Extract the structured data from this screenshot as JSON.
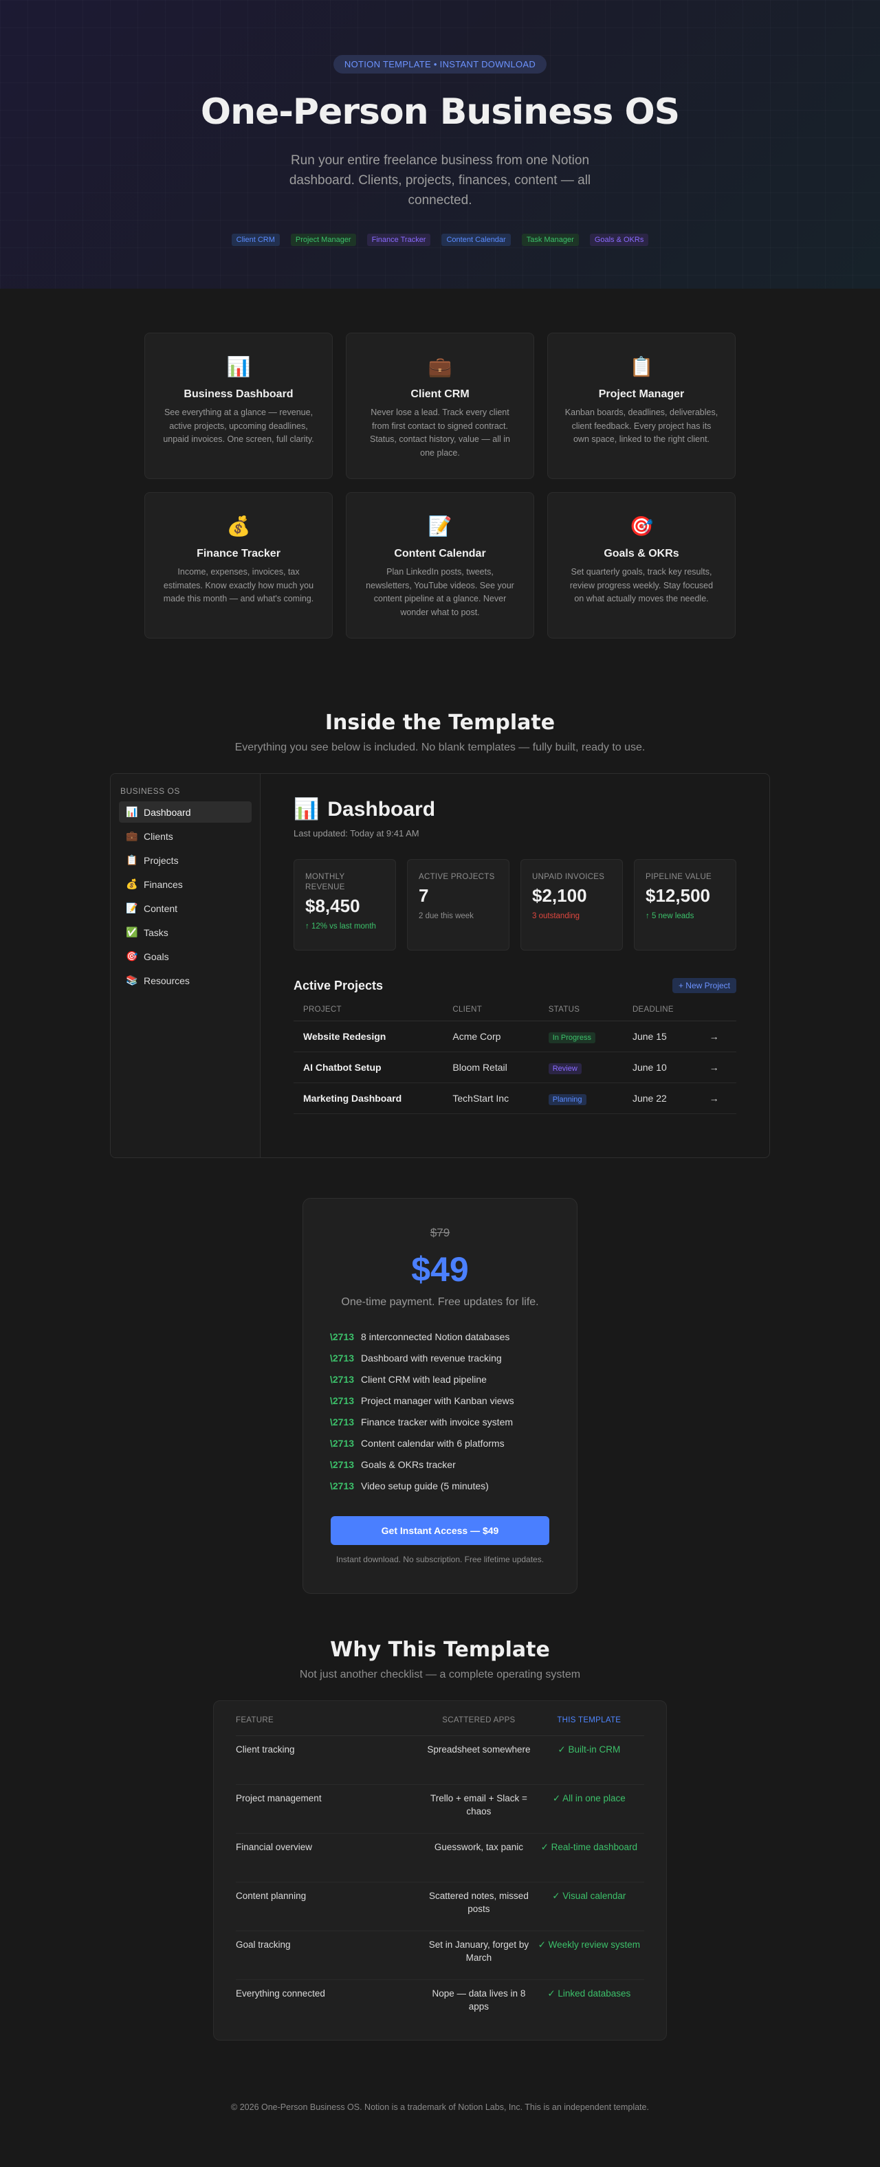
{
  "hero": {
    "badge": "NOTION TEMPLATE • INSTANT DOWNLOAD",
    "title": "One-Person Business OS",
    "subtitle": "Run your entire freelance business from one Notion dashboard. Clients, projects, finances, content — all connected.",
    "chips": [
      {
        "label": "Client CRM",
        "color": "#5b8cff",
        "bg": "#22304f"
      },
      {
        "label": "Project Manager",
        "color": "#3cc06a",
        "bg": "#1d3526"
      },
      {
        "label": "Finance Tracker",
        "color": "#8a6bff",
        "bg": "#2b2545"
      },
      {
        "label": "Content Calendar",
        "color": "#5b8cff",
        "bg": "#22304f"
      },
      {
        "label": "Task Manager",
        "color": "#3cc06a",
        "bg": "#1d3526"
      },
      {
        "label": "Goals & OKRs",
        "color": "#8a6bff",
        "bg": "#2b2545"
      }
    ]
  },
  "features": [
    {
      "icon": "📊",
      "icon_name": "bar-chart-icon",
      "title": "Business Dashboard",
      "desc": "See everything at a glance — revenue, active projects, upcoming deadlines, unpaid invoices. One screen, full clarity."
    },
    {
      "icon": "💼",
      "icon_name": "briefcase-icon",
      "title": "Client CRM",
      "desc": "Never lose a lead. Track every client from first contact to signed contract. Status, contact history, value — all in one place."
    },
    {
      "icon": "📋",
      "icon_name": "clipboard-icon",
      "title": "Project Manager",
      "desc": "Kanban boards, deadlines, deliverables, client feedback. Every project has its own space, linked to the right client."
    },
    {
      "icon": "💰",
      "icon_name": "money-bag-icon",
      "title": "Finance Tracker",
      "desc": "Income, expenses, invoices, tax estimates. Know exactly how much you made this month — and what's coming."
    },
    {
      "icon": "📝",
      "icon_name": "memo-icon",
      "title": "Content Calendar",
      "desc": "Plan LinkedIn posts, tweets, newsletters, YouTube videos. See your content pipeline at a glance. Never wonder what to post."
    },
    {
      "icon": "🎯",
      "icon_name": "target-icon",
      "title": "Goals & OKRs",
      "desc": "Set quarterly goals, track key results, review progress weekly. Stay focused on what actually moves the needle."
    }
  ],
  "inside": {
    "title": "Inside the Template",
    "subtitle": "Everything you see below is included. No blank templates — fully built, ready to use."
  },
  "mock": {
    "workspace": "BUSINESS OS",
    "nav": [
      {
        "icon": "📊",
        "icon_name": "bar-chart-icon",
        "label": "Dashboard",
        "active": true
      },
      {
        "icon": "💼",
        "icon_name": "briefcase-icon",
        "label": "Clients"
      },
      {
        "icon": "📋",
        "icon_name": "clipboard-icon",
        "label": "Projects"
      },
      {
        "icon": "💰",
        "icon_name": "money-bag-icon",
        "label": "Finances"
      },
      {
        "icon": "📝",
        "icon_name": "memo-icon",
        "label": "Content"
      },
      {
        "icon": "✅",
        "icon_name": "check-box-icon",
        "label": "Tasks"
      },
      {
        "icon": "🎯",
        "icon_name": "target-icon",
        "label": "Goals"
      },
      {
        "icon": "📚",
        "icon_name": "books-icon",
        "label": "Resources"
      }
    ],
    "dashboard": {
      "icon": "📊",
      "title": "Dashboard",
      "updated": "Last updated: Today at 9:41 AM",
      "stats": [
        {
          "label": "MONTHLY REVENUE",
          "value": "$8,450",
          "note": "↑ 12% vs last month",
          "note_color": "#3cc06a"
        },
        {
          "label": "ACTIVE PROJECTS",
          "value": "7",
          "note": "2 due this week",
          "note_color": "#8e8e8e"
        },
        {
          "label": "UNPAID INVOICES",
          "value": "$2,100",
          "note": "3 outstanding",
          "note_color": "#e0473f"
        },
        {
          "label": "PIPELINE VALUE",
          "value": "$12,500",
          "note": "↑ 5 new leads",
          "note_color": "#3cc06a"
        }
      ],
      "projects_title": "Active Projects",
      "new_project": "+ New Project",
      "columns": [
        "PROJECT",
        "CLIENT",
        "STATUS",
        "DEADLINE",
        ""
      ],
      "rows": [
        {
          "name": "Website Redesign",
          "client": "Acme Corp",
          "status": "In Progress",
          "status_color": "#3cc06a",
          "status_bg": "#1d3526",
          "deadline": "June 15",
          "arrow": "→"
        },
        {
          "name": "AI Chatbot Setup",
          "client": "Bloom Retail",
          "status": "Review",
          "status_color": "#8a6bff",
          "status_bg": "#2b2545",
          "deadline": "June 10",
          "arrow": "→"
        },
        {
          "name": "Marketing Dashboard",
          "client": "TechStart Inc",
          "status": "Planning",
          "status_color": "#5b8cff",
          "status_bg": "#22304f",
          "deadline": "June 22",
          "arrow": "→"
        }
      ]
    }
  },
  "pricing": {
    "old_price": "$79",
    "price": "$49",
    "note": "One-time payment. Free updates for life.",
    "check": "\\2713",
    "items": [
      "8 interconnected Notion databases",
      "Dashboard with revenue tracking",
      "Client CRM with lead pipeline",
      "Project manager with Kanban views",
      "Finance tracker with invoice system",
      "Content calendar with 6 platforms",
      "Goals & OKRs tracker",
      "Video setup guide (5 minutes)"
    ],
    "cta": "Get Instant Access — $49",
    "fine": "Instant download. No subscription. Free lifetime updates."
  },
  "why": {
    "title": "Why This Template",
    "subtitle": "Not just another checklist — a complete operating system",
    "headers": [
      "FEATURE",
      "SCATTERED APPS",
      "THIS TEMPLATE"
    ],
    "rows": [
      {
        "feature": "Client tracking",
        "apps": "Spreadsheet somewhere",
        "ours": "✓ Built-in CRM"
      },
      {
        "feature": "Project management",
        "apps": "Trello + email + Slack = chaos",
        "ours": "✓ All in one place"
      },
      {
        "feature": "Financial overview",
        "apps": "Guesswork, tax panic",
        "ours": "✓ Real-time dashboard"
      },
      {
        "feature": "Content planning",
        "apps": "Scattered notes, missed posts",
        "ours": "✓ Visual calendar"
      },
      {
        "feature": "Goal tracking",
        "apps": "Set in January, forget by March",
        "ours": "✓ Weekly review system"
      },
      {
        "feature": "Everything connected",
        "apps": "Nope — data lives in 8 apps",
        "ours": "✓ Linked databases"
      }
    ]
  },
  "footer": "© 2026 One-Person Business OS. Notion is a trademark of Notion Labs, Inc. This is an independent template."
}
